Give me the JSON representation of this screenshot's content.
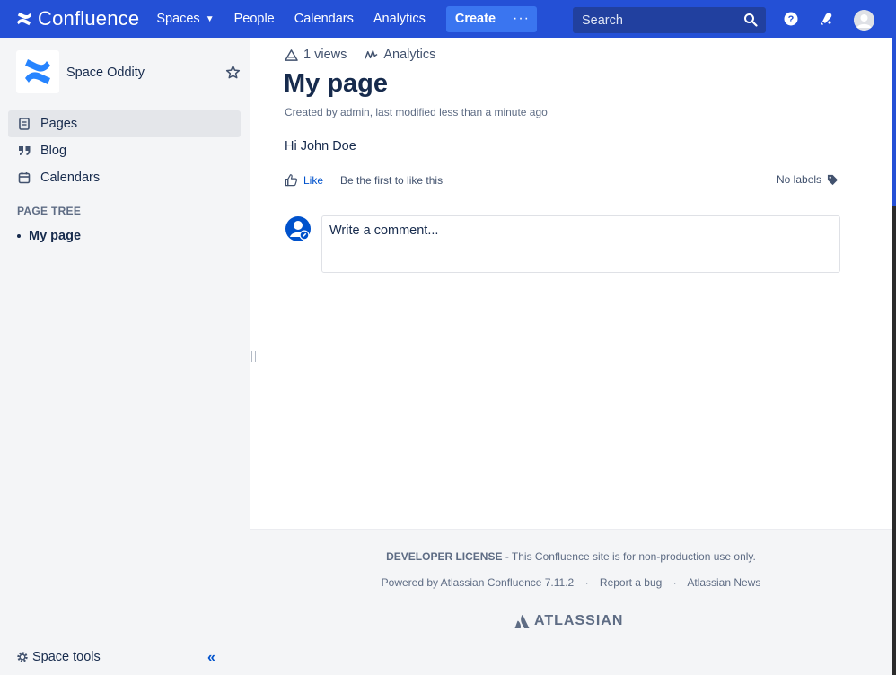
{
  "topbar": {
    "brand": "Confluence",
    "nav": [
      "Spaces",
      "People",
      "Calendars",
      "Analytics"
    ],
    "create_label": "Create",
    "more_label": "···",
    "search_placeholder": "Search"
  },
  "sidebar": {
    "space_name": "Space Oddity",
    "items": [
      {
        "label": "Pages",
        "icon": "pages-icon",
        "active": true
      },
      {
        "label": "Blog",
        "icon": "quote-icon",
        "active": false
      },
      {
        "label": "Calendars",
        "icon": "calendar-icon",
        "active": false
      }
    ],
    "tree_heading": "PAGE TREE",
    "tree_items": [
      "My page"
    ],
    "space_tools_label": "Space tools",
    "collapse_label": "«"
  },
  "page": {
    "views": "1 views",
    "analytics": "Analytics",
    "title": "My page",
    "byline": "Created by admin, last modified less than a minute ago",
    "body": "Hi John Doe",
    "like_label": "Like",
    "first_like": "Be the first to like this",
    "labels_text": "No labels",
    "comment_placeholder": "Write a comment..."
  },
  "footer": {
    "license_bold": "DEVELOPER LICENSE",
    "license_rest": " - This Confluence site is for non-production use only.",
    "powered": "Powered by Atlassian Confluence 7.11.2",
    "report": "Report a bug",
    "news": "Atlassian News",
    "sep": "·",
    "brand": "ATLASSIAN"
  },
  "colors": {
    "topbar": "#2450d6",
    "link": "#0052cc",
    "text": "#172b4d",
    "sidebar": "#f4f5f7"
  }
}
